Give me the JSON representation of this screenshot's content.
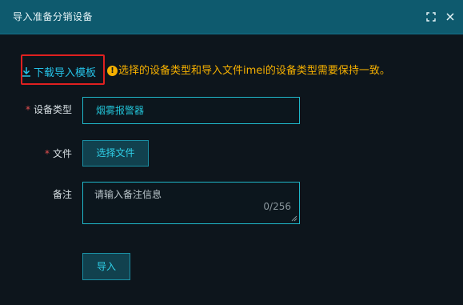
{
  "dialog": {
    "title": "导入准备分销设备",
    "maximize_icon": "maximize-icon",
    "close_icon": "close-icon"
  },
  "download": {
    "label": "下载导入模板",
    "icon": "download-icon"
  },
  "notice": {
    "icon": "warning-icon",
    "icon_glyph": "!",
    "text": "选择的设备类型和导入文件imei的设备类型需要保持一致。",
    "color": "#f5b000"
  },
  "form": {
    "required_mark": "*",
    "device_type": {
      "label": "设备类型",
      "value": "烟雾报警器"
    },
    "file": {
      "label": "文件",
      "button": "选择文件"
    },
    "remark": {
      "label": "备注",
      "placeholder": "请输入备注信息",
      "counter": "0/256"
    },
    "submit": "导入"
  },
  "colors": {
    "title_bar": "#0e5a6e",
    "accent": "#25c3e8",
    "highlight_border": "#e02020"
  }
}
